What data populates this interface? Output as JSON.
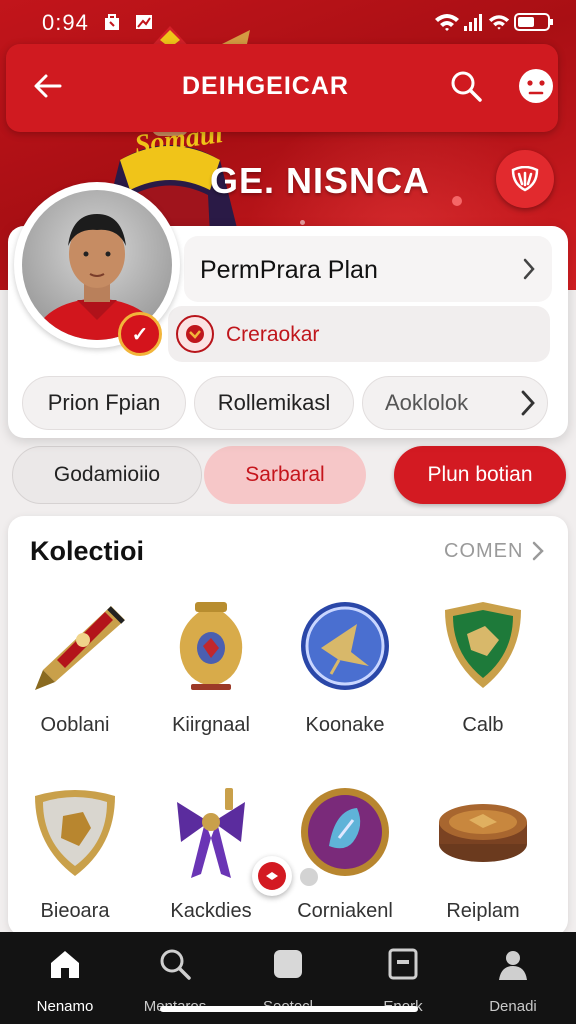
{
  "status_bar": {
    "time": "0:94"
  },
  "app_bar": {
    "title": "DEIHGEICAR"
  },
  "hero": {
    "team_name": "GE. NISNCA",
    "jersey_text": "Somaul"
  },
  "profile": {
    "plan_label": "PermPrara Plan",
    "sub_label": "Creraokar",
    "chips": [
      "Prion Fpian",
      "Rollemikasl",
      "Aoklolok"
    ]
  },
  "actions": [
    "Godamioiio",
    "Sarbaral",
    "Plun botian"
  ],
  "collection": {
    "title": "Kolectioi",
    "see_all": "COMEN",
    "items": [
      {
        "name": "Ooblani",
        "icon": "rocket-pen-icon"
      },
      {
        "name": "Kiirgnaal",
        "icon": "golden-vase-icon"
      },
      {
        "name": "Koonake",
        "icon": "kite-medal-icon"
      },
      {
        "name": "Calb",
        "icon": "green-shield-icon"
      },
      {
        "name": "Bieoara",
        "icon": "silver-shield-icon"
      },
      {
        "name": "Kackdies",
        "icon": "purple-ribbon-icon"
      },
      {
        "name": "Corniakenl",
        "icon": "purple-medal-icon"
      },
      {
        "name": "Reiplam",
        "icon": "bronze-disc-icon"
      }
    ]
  },
  "bottom_nav": [
    {
      "label": "Nenamo",
      "icon": "home-icon"
    },
    {
      "label": "Mentaros",
      "icon": "search-icon"
    },
    {
      "label": "Seotecl",
      "icon": "square-icon"
    },
    {
      "label": "Enork",
      "icon": "device-icon"
    },
    {
      "label": "Denadi",
      "icon": "profile-icon"
    }
  ],
  "colors": {
    "primary_red": "#d01a20",
    "nav_bg": "#131313",
    "card_bg": "#ffffff"
  }
}
